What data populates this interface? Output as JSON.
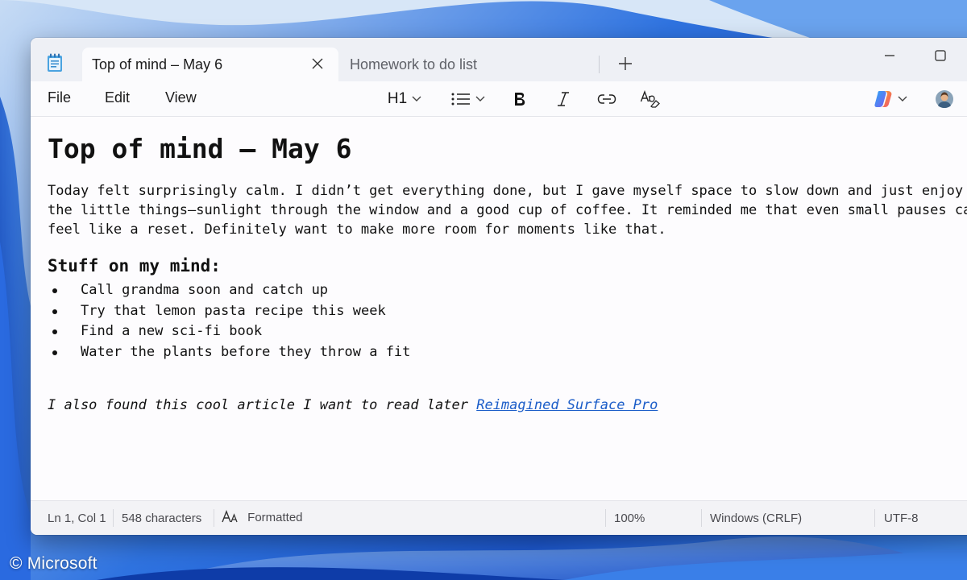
{
  "watermark": "© Microsoft",
  "tabs": [
    {
      "label": "Top of mind – May 6",
      "active": true
    },
    {
      "label": "Homework to do list",
      "active": false
    }
  ],
  "menu": {
    "file": "File",
    "edit": "Edit",
    "view": "View"
  },
  "toolbar": {
    "heading_level": "H1",
    "icons": [
      "list-icon",
      "bold-icon",
      "italic-icon",
      "link-icon",
      "clear-formatting-icon",
      "copilot-icon",
      "avatar"
    ]
  },
  "document": {
    "title": "Top of mind – May 6",
    "paragraph_lines": [
      "Today felt surprisingly calm. I didn’t get everything done, but I gave myself space to slow down and just enjoy",
      "the little things—sunlight through the window and a good cup of coffee. It reminded me that even small pauses can",
      "feel like a reset. Definitely want to make more room for moments like that."
    ],
    "subheading": "Stuff on my mind:",
    "bullets": [
      "Call grandma soon and catch up",
      "Try that lemon pasta recipe this week",
      "Find a new sci-fi book",
      "Water the plants before they throw a fit"
    ],
    "closing_text": "I also found this cool article I want to read later ",
    "link_text": "Reimagined Surface Pro"
  },
  "status": {
    "position": "Ln 1, Col 1",
    "characters": "548 characters",
    "format": "Formatted",
    "zoom": "100%",
    "line_ending": "Windows (CRLF)",
    "encoding": "UTF-8"
  },
  "colors": {
    "link": "#1a5cc8",
    "copilot": "#7b5cf0"
  }
}
